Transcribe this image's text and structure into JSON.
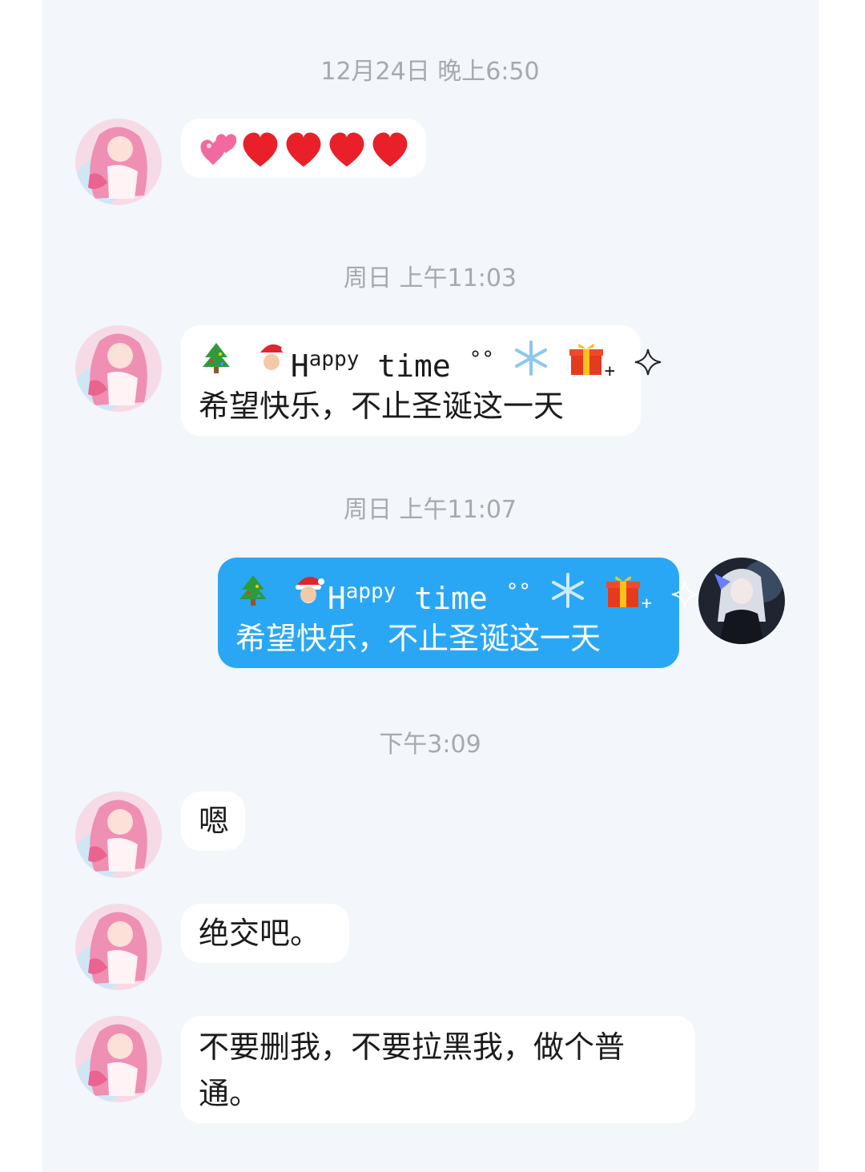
{
  "chat": {
    "timestamps": {
      "t1": "12月24日 晚上6:50",
      "t2": "周日 上午11:03",
      "t3": "周日 上午11:07",
      "t4": "下午3:09"
    },
    "messages": {
      "m2": {
        "line1_text_a": "H",
        "line1_text_sup": "appy",
        "line1_text_b": " time ",
        "line1_text_c": "°°",
        "line2": "希望快乐，不止圣诞这一天"
      },
      "m3": {
        "line1_text_a": "H",
        "line1_text_sup": "appy",
        "line1_text_b": " time ",
        "line1_text_c": "°°",
        "line2": "希望快乐，不止圣诞这一天"
      },
      "m4": {
        "text": "嗯"
      },
      "m5": {
        "text": "绝交吧。"
      },
      "m6": {
        "line1": "不要删我，不要拉黑我，做个普",
        "line2": "通。"
      }
    },
    "icons": [
      "two-hearts-icon",
      "red-heart-icon",
      "christmas-tree-icon",
      "santa-icon",
      "snowflake-icon",
      "gift-icon",
      "sparkle-icon"
    ],
    "colors": {
      "background": "#f3f6fb",
      "incoming_bubble": "#ffffff",
      "outgoing_bubble": "#2aa7f4",
      "timestamp": "#a5a9b1"
    }
  }
}
